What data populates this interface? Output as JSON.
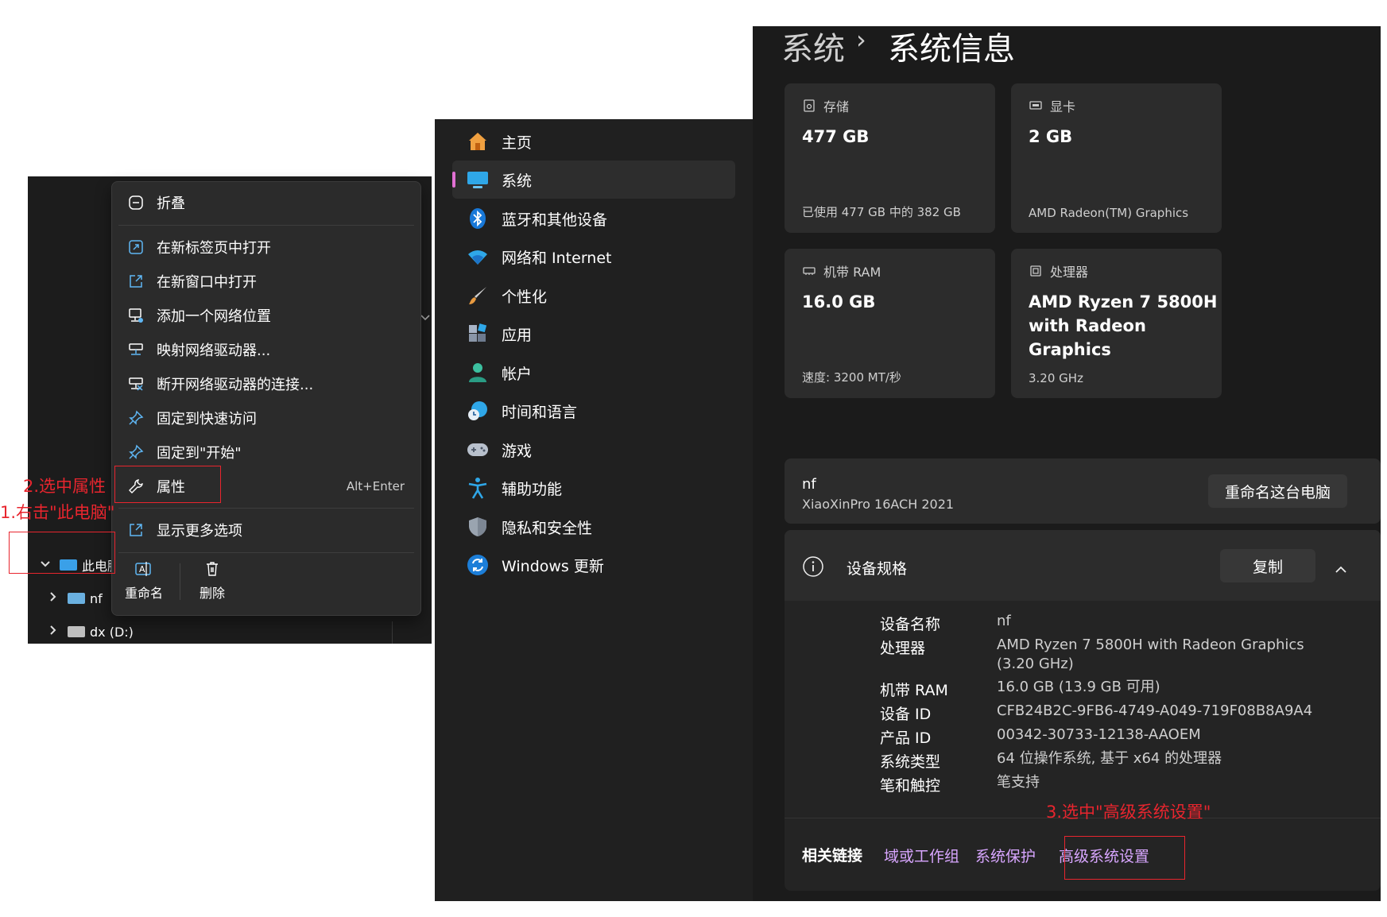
{
  "explorer": {
    "tree": [
      {
        "name": "此电脑",
        "expanded": true
      },
      {
        "name": "nf",
        "expanded": false
      },
      {
        "name": "dx (D:)",
        "expanded": false
      }
    ]
  },
  "context_menu": {
    "items": [
      {
        "label": "折叠",
        "icon": "collapse-icon"
      },
      {
        "label": "在新标签页中打开",
        "icon": "open-new-tab-icon"
      },
      {
        "label": "在新窗口中打开",
        "icon": "open-new-window-icon"
      },
      {
        "label": "添加一个网络位置",
        "icon": "network-location-icon"
      },
      {
        "label": "映射网络驱动器...",
        "icon": "map-drive-icon"
      },
      {
        "label": "断开网络驱动器的连接...",
        "icon": "disconnect-drive-icon"
      },
      {
        "label": "固定到快速访问",
        "icon": "pin-icon"
      },
      {
        "label": "固定到\"开始\"",
        "icon": "pin-start-icon"
      },
      {
        "label": "属性",
        "icon": "wrench-icon",
        "shortcut": "Alt+Enter"
      },
      {
        "label": "显示更多选项",
        "icon": "more-options-icon"
      }
    ],
    "bottom_actions": [
      {
        "label": "重命名",
        "icon": "rename-icon"
      },
      {
        "label": "删除",
        "icon": "trash-icon"
      }
    ]
  },
  "annotations": {
    "step1": "1.右击\"此电脑\"",
    "step2": "2.选中属性",
    "step3": "3.选中\"高级系统设置\"",
    "color": "#e8252e"
  },
  "settings_nav": {
    "items": [
      {
        "label": "主页",
        "icon": "home-icon"
      },
      {
        "label": "系统",
        "icon": "system-icon",
        "active": true
      },
      {
        "label": "蓝牙和其他设备",
        "icon": "bluetooth-icon"
      },
      {
        "label": "网络和 Internet",
        "icon": "wifi-icon"
      },
      {
        "label": "个性化",
        "icon": "brush-icon"
      },
      {
        "label": "应用",
        "icon": "apps-icon"
      },
      {
        "label": "帐户",
        "icon": "account-icon"
      },
      {
        "label": "时间和语言",
        "icon": "time-language-icon"
      },
      {
        "label": "游戏",
        "icon": "gamepad-icon"
      },
      {
        "label": "辅助功能",
        "icon": "accessibility-icon"
      },
      {
        "label": "隐私和安全性",
        "icon": "shield-icon"
      },
      {
        "label": "Windows 更新",
        "icon": "update-icon"
      }
    ],
    "active_color": "#e170d3"
  },
  "settings_content": {
    "breadcrumb": {
      "parent": "系统",
      "separator": "›",
      "current": "系统信息"
    },
    "cards": {
      "storage": {
        "title": "存储",
        "value": "477 GB",
        "sub": "已使用 477 GB 中的 382 GB"
      },
      "gpu": {
        "title": "显卡",
        "value": "2 GB",
        "sub": "AMD Radeon(TM) Graphics"
      },
      "ram": {
        "title": "机带 RAM",
        "value": "16.0 GB",
        "sub": "速度: 3200 MT/秒"
      },
      "cpu": {
        "title": "处理器",
        "value_line1": "AMD Ryzen 7 5800H",
        "value_line2": "with Radeon Graphics",
        "sub": "3.20 GHz"
      }
    },
    "device": {
      "name": "nf",
      "model": "XiaoXinPro 16ACH 2021",
      "rename_button": "重命名这台电脑"
    },
    "specs": {
      "title": "设备规格",
      "copy_button": "复制",
      "rows": [
        {
          "label": "设备名称",
          "value": "nf"
        },
        {
          "label": "处理器",
          "value": "AMD Ryzen 7 5800H with Radeon Graphics",
          "value2": "(3.20 GHz)"
        },
        {
          "label": "机带 RAM",
          "value": "16.0 GB (13.9 GB 可用)"
        },
        {
          "label": "设备 ID",
          "value": "CFB24B2C-9FB6-4749-A049-719F08B8A9A4"
        },
        {
          "label": "产品 ID",
          "value": "00342-30733-12138-AAOEM"
        },
        {
          "label": "系统类型",
          "value": "64 位操作系统, 基于 x64 的处理器"
        },
        {
          "label": "笔和触控",
          "value": "笔支持"
        }
      ]
    },
    "related_links": {
      "label": "相关链接",
      "links": [
        "域或工作组",
        "系统保护",
        "高级系统设置"
      ],
      "link_color": "#d8a6ff"
    }
  }
}
